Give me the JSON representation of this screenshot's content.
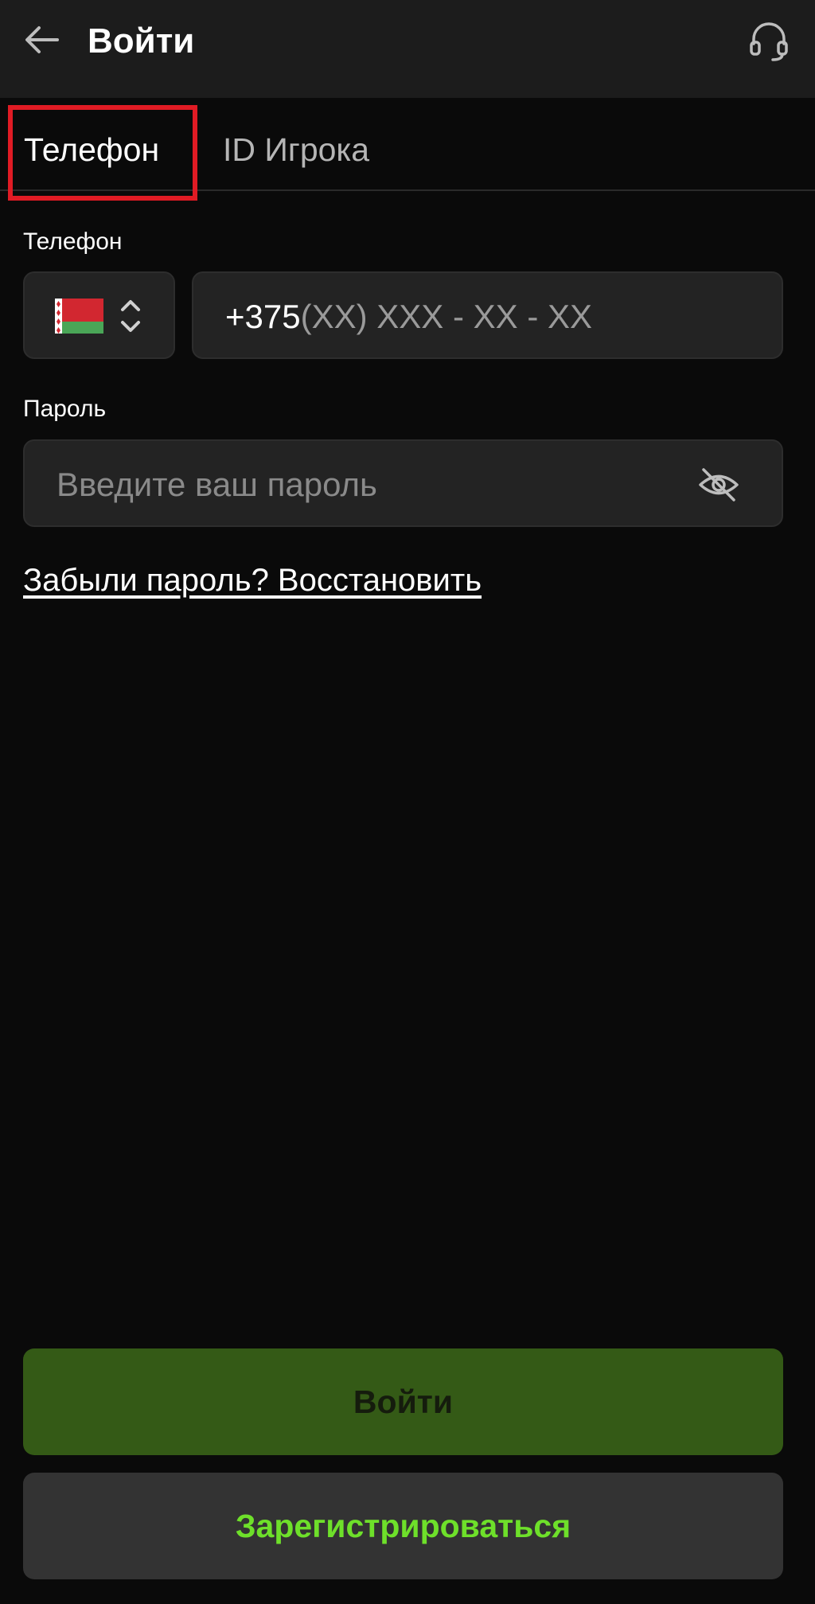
{
  "header": {
    "title": "Войти",
    "back_icon": "arrow-left-icon",
    "support_icon": "headset-icon"
  },
  "tabs": [
    {
      "label": "Телефон",
      "active": true
    },
    {
      "label": "ID Игрока",
      "active": false
    }
  ],
  "phone_field": {
    "label": "Телефон",
    "country_flag": "belarus-flag",
    "country_code": "+375",
    "mask": "(XX) XXX - XX - XX"
  },
  "password_field": {
    "label": "Пароль",
    "placeholder": "Введите ваш пароль",
    "visibility_icon": "eye-off-icon"
  },
  "forgot_password_link": "Забыли пароль? Восстановить",
  "buttons": {
    "login": "Войти",
    "register": "Зарегистрироваться"
  },
  "colors": {
    "background": "#0a0a0a",
    "header_bg": "#1c1c1c",
    "input_bg": "#232323",
    "login_button_bg": "#345a16",
    "register_text": "#6ee02a",
    "highlight_border": "#e01b24"
  }
}
